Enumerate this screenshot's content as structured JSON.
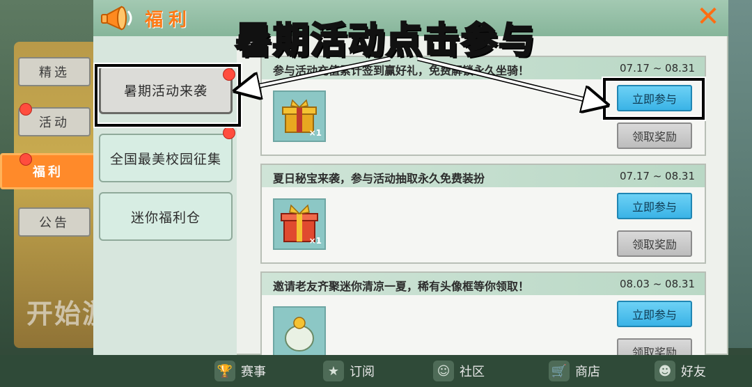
{
  "background": {
    "start_text": "开始游"
  },
  "categories": [
    {
      "label": "精选",
      "active": false,
      "dot": false
    },
    {
      "label": "活动",
      "active": false,
      "dot": true
    },
    {
      "label": "福利",
      "active": true,
      "dot": true
    },
    {
      "label": "公告",
      "active": false,
      "dot": false
    }
  ],
  "panel": {
    "title": "福利",
    "close_symbol": "✕"
  },
  "sub_tabs": [
    {
      "label": "暑期活动来袭",
      "active": true,
      "dot": true
    },
    {
      "label": "全国最美校园征集",
      "active": false,
      "dot": true
    },
    {
      "label": "迷你福利仓",
      "active": false,
      "dot": false
    }
  ],
  "cards": [
    {
      "title": "参与活动充值累计签到赢好礼，免费解锁永久坐骑！",
      "date": "07.17 ~ 08.31",
      "item_count": "×1",
      "join_label": "立即参与",
      "claim_label": "领取奖励"
    },
    {
      "title": "夏日秘宝来袭，参与活动抽取永久免费装扮",
      "date": "07.17 ~ 08.31",
      "item_count": "×1",
      "join_label": "立即参与",
      "claim_label": "领取奖励"
    },
    {
      "title": "邀请老友齐聚迷你清凉一夏，稀有头像框等你领取！",
      "date": "08.03 ~ 08.31",
      "item_count": "",
      "join_label": "立即参与",
      "claim_label": "领取奖励"
    }
  ],
  "bottom_nav": [
    {
      "label": "赛事",
      "icon": "trophy-icon"
    },
    {
      "label": "订阅",
      "icon": "subscribe-icon"
    },
    {
      "label": "社区",
      "icon": "community-icon"
    },
    {
      "label": "商店",
      "icon": "shop-cart-icon"
    },
    {
      "label": "好友",
      "icon": "friends-icon"
    }
  ],
  "overlay": {
    "caption": "暑期活动点击参与"
  },
  "colors": {
    "accent": "#ff7a16",
    "join": "#3ab3e6",
    "dot": "#ff4d3e"
  }
}
